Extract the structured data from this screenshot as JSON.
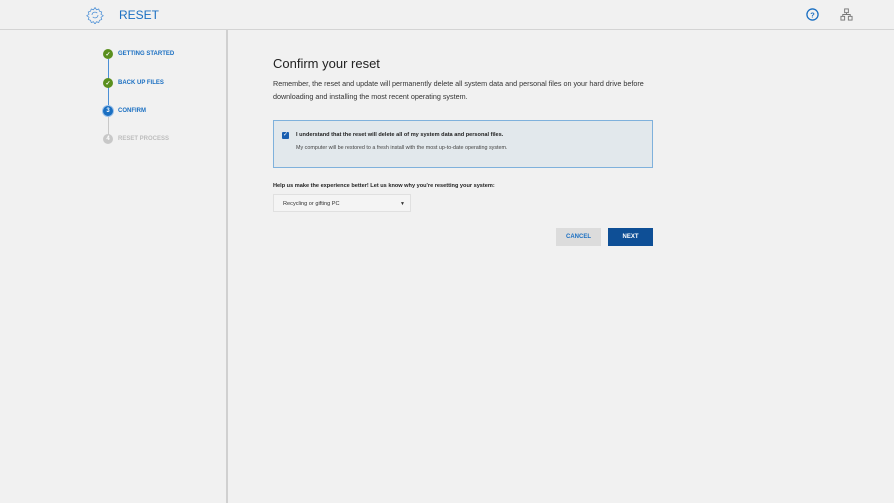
{
  "header": {
    "title": "RESET",
    "icons": [
      "gear-icon",
      "help-icon",
      "network-icon"
    ]
  },
  "steps": [
    {
      "label": "GETTING STARTED",
      "status": "done"
    },
    {
      "label": "BACK UP FILES",
      "status": "done"
    },
    {
      "label": "CONFIRM",
      "number": "3",
      "status": "current"
    },
    {
      "label": "RESET PROCESS",
      "number": "4",
      "status": "pending"
    }
  ],
  "main": {
    "title": "Confirm your reset",
    "description": "Remember, the reset and update will permanently delete all system data and personal files on your hard drive before downloading and installing the most recent operating system.",
    "confirm": {
      "checked": true,
      "label": "I understand that the reset will delete all of my system data and personal files.",
      "sublabel": "My computer will be restored to a fresh install with the most up-to-date operating system."
    },
    "reason_label": "Help us make the experience better! Let us know why you're resetting your system:",
    "reason_value": "Recycling or gifting PC",
    "cancel": "CANCEL",
    "next": "NEXT"
  }
}
